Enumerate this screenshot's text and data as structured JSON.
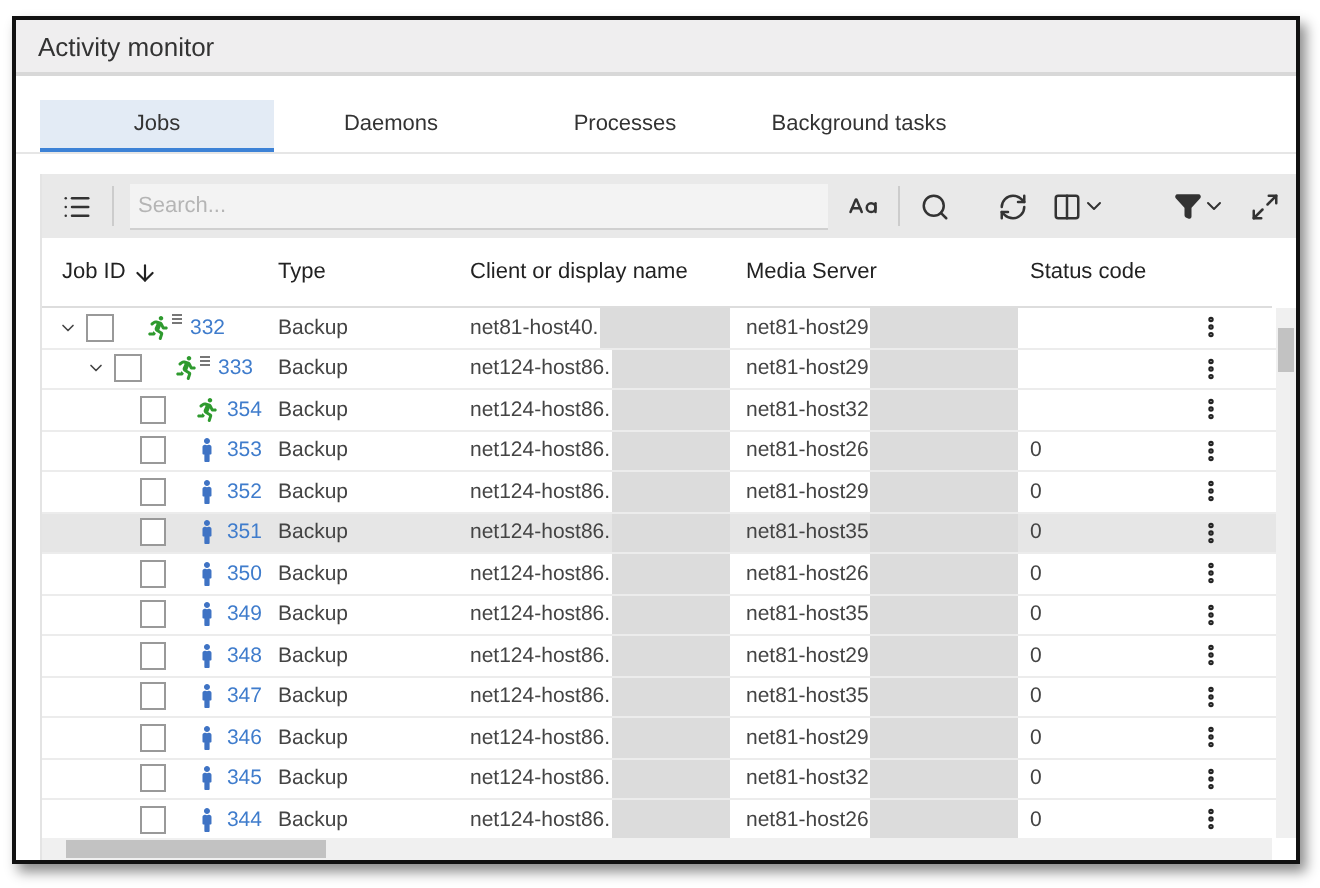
{
  "window": {
    "title": "Activity monitor"
  },
  "tabs": [
    {
      "label": "Jobs",
      "selected": true
    },
    {
      "label": "Daemons",
      "selected": false
    },
    {
      "label": "Processes",
      "selected": false
    },
    {
      "label": "Background tasks",
      "selected": false
    }
  ],
  "toolbar": {
    "search": {
      "placeholder": "Search..."
    }
  },
  "table": {
    "columns": [
      {
        "label": "Job ID",
        "sorted": true
      },
      {
        "label": "Type"
      },
      {
        "label": "Client or display name"
      },
      {
        "label": "Media Server"
      },
      {
        "label": "Status code"
      }
    ],
    "rows": [
      {
        "job_id": "332",
        "type": "Backup",
        "client": "net81-host40.",
        "media_server": "net81-host29",
        "kind": "running",
        "checked": false,
        "expanded": true,
        "selected": false,
        "children": [
          {
            "job_id": "333",
            "type": "Backup",
            "client": "net124-host86.",
            "media_server": "net81-host29",
            "kind": "running",
            "checked": false,
            "expanded": true,
            "selected": false,
            "children": [
              {
                "job_id": "354",
                "type": "Backup",
                "client": "net124-host86.",
                "media_server": "net81-host32",
                "kind": "running",
                "checked": false,
                "selected": false
              },
              {
                "job_id": "353",
                "type": "Backup",
                "client": "net124-host86.",
                "media_server": "net81-host26",
                "status_code": "0",
                "kind": "done",
                "checked": false,
                "selected": false
              },
              {
                "job_id": "352",
                "type": "Backup",
                "client": "net124-host86.",
                "media_server": "net81-host29",
                "status_code": "0",
                "kind": "done",
                "checked": false,
                "selected": false
              },
              {
                "job_id": "351",
                "type": "Backup",
                "client": "net124-host86.",
                "media_server": "net81-host35",
                "status_code": "0",
                "kind": "done",
                "checked": false,
                "selected": true
              },
              {
                "job_id": "350",
                "type": "Backup",
                "client": "net124-host86.",
                "media_server": "net81-host26",
                "status_code": "0",
                "kind": "done",
                "checked": false,
                "selected": false
              },
              {
                "job_id": "349",
                "type": "Backup",
                "client": "net124-host86.",
                "media_server": "net81-host35",
                "status_code": "0",
                "kind": "done",
                "checked": false,
                "selected": false
              },
              {
                "job_id": "348",
                "type": "Backup",
                "client": "net124-host86.",
                "media_server": "net81-host29",
                "status_code": "0",
                "kind": "done",
                "checked": false,
                "selected": false
              },
              {
                "job_id": "347",
                "type": "Backup",
                "client": "net124-host86.",
                "media_server": "net81-host35",
                "status_code": "0",
                "kind": "done",
                "checked": false,
                "selected": false
              },
              {
                "job_id": "346",
                "type": "Backup",
                "client": "net124-host86.",
                "media_server": "net81-host29",
                "status_code": "0",
                "kind": "done",
                "checked": false,
                "selected": false
              },
              {
                "job_id": "345",
                "type": "Backup",
                "client": "net124-host86.",
                "media_server": "net81-host32",
                "status_code": "0",
                "kind": "done",
                "checked": false,
                "selected": false
              },
              {
                "job_id": "344",
                "type": "Backup",
                "client": "net124-host86.",
                "media_server": "net81-host26",
                "status_code": "0",
                "kind": "done",
                "checked": false,
                "selected": false
              }
            ]
          }
        ]
      }
    ]
  }
}
